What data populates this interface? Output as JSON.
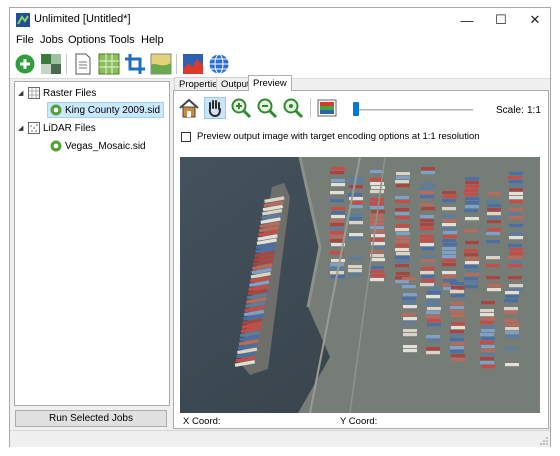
{
  "window": {
    "title": "Unlimited [Untitled*]",
    "minimize_glyph": "—",
    "maximize_glyph": "☐",
    "close_glyph": "✕"
  },
  "menu": [
    "File",
    "Jobs",
    "Options",
    "Tools",
    "Help"
  ],
  "toolbar_icons": [
    "add-job-icon",
    "mosaic-icon",
    "document-icon",
    "grid-icon",
    "crop-icon",
    "map-icon",
    "chart-icon",
    "globe-icon"
  ],
  "tree": {
    "raster": {
      "label": "Raster Files",
      "expander": "◢",
      "children": [
        {
          "label": "King County 2009.sid",
          "selected": true
        }
      ]
    },
    "lidar": {
      "label": "LiDAR Files",
      "expander": "◢",
      "children": [
        {
          "label": "Vegas_Mosaic.sid",
          "selected": false
        }
      ]
    }
  },
  "run_button": "Run Selected Jobs",
  "tabs": [
    {
      "label": "Properties",
      "active": false
    },
    {
      "label": "Output",
      "active": false
    },
    {
      "label": "Preview",
      "active": true
    }
  ],
  "preview_toolbar": {
    "icons": [
      "home-icon",
      "pan-hand-icon",
      "zoom-in-icon",
      "zoom-out-icon",
      "zoom-fit-icon",
      "bands-icon"
    ],
    "scale_label": "Scale:",
    "scale_value": "1:1",
    "slider_value": 0
  },
  "preview_option": {
    "label": "Preview output image with target encoding options at 1:1 resolution",
    "checked": false
  },
  "coords": {
    "x_label": "X Coord:",
    "y_label": "Y Coord:"
  },
  "colors": {
    "accent": "#0078d7",
    "selection": "#cce8ff",
    "water": "#3b464f",
    "ground": "#7c8279"
  }
}
